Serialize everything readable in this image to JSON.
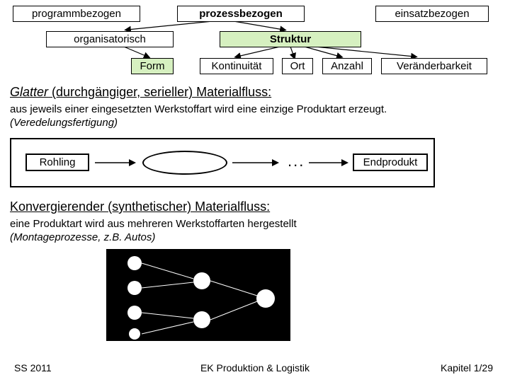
{
  "row1": {
    "a": "programmbezogen",
    "b": "prozessbezogen",
    "c": "einsatzbezogen"
  },
  "row2": {
    "a": "organisatorisch",
    "b": "Struktur"
  },
  "row3": {
    "form": "Form",
    "kont": "Kontinuität",
    "ort": "Ort",
    "anzahl": "Anzahl",
    "ver": "Veränderbarkeit"
  },
  "sec1": {
    "heading_strong": "Glatter",
    "heading_rest": " (durchgängiger, serieller) Materialfluss:",
    "body_line1": "aus jeweils einer eingesetzten Werkstoffart wird eine einzige Produktart erzeugt.",
    "body_line2": "(Veredelungsfertigung)"
  },
  "diagram1": {
    "left": "Rohling",
    "right": "Endprodukt",
    "dots": "..."
  },
  "sec2": {
    "heading_strong": "Konvergierender (synthetischer) Materialfluss:",
    "body_line1": "eine Produktart wird aus mehreren Werkstoffarten hergestellt",
    "body_line2": "(Montageprozesse, z.B. Autos)"
  },
  "footer": {
    "left": "SS 2011",
    "center": "EK Produktion & Logistik",
    "right": "Kapitel 1/29"
  }
}
